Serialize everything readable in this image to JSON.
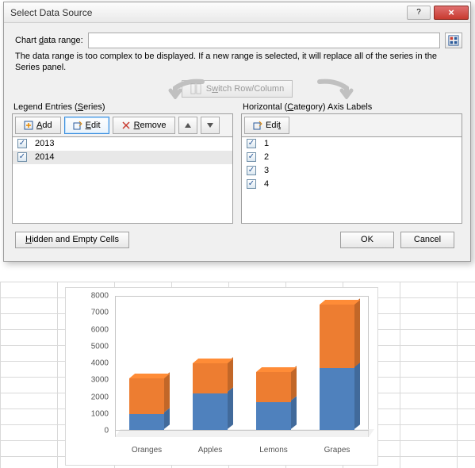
{
  "dialog": {
    "title": "Select Data Source",
    "range_label_pre": "Chart ",
    "range_label_ul": "d",
    "range_label_post": "ata range:",
    "range_value": "",
    "note": "The data range is too complex to be displayed. If a new range is selected, it will replace all of the series in the Series panel.",
    "switch_label_pre": "S",
    "switch_label_ul": "w",
    "switch_label_post": "itch Row/Column",
    "legend_caption_pre": "Legend Entries (",
    "legend_caption_ul": "S",
    "legend_caption_post": "eries)",
    "axis_caption_pre": "Horizontal (",
    "axis_caption_ul": "C",
    "axis_caption_post": "ategory) Axis Labels",
    "add_ul": "A",
    "add_post": "dd",
    "edit_ul": "E",
    "edit_post": "dit",
    "edit2_pre": "Edi",
    "edit2_ul": "t",
    "remove_ul": "R",
    "remove_post": "emove",
    "hidden_ul": "H",
    "hidden_post": "idden and Empty Cells",
    "ok": "OK",
    "cancel": "Cancel",
    "series": [
      "2013",
      "2014"
    ],
    "categories": [
      "1",
      "2",
      "3",
      "4"
    ]
  },
  "chart_data": {
    "type": "bar",
    "stacked": true,
    "three_d": true,
    "categories": [
      "Oranges",
      "Apples",
      "Lemons",
      "Grapes"
    ],
    "series": [
      {
        "name": "2013",
        "color": "#4f81bd",
        "values": [
          1000,
          2200,
          1700,
          3700
        ]
      },
      {
        "name": "2014",
        "color": "#ed7d31",
        "values": [
          2100,
          1800,
          1800,
          3800
        ]
      }
    ],
    "ylim": [
      0,
      8000
    ],
    "yticks": [
      0,
      1000,
      2000,
      3000,
      4000,
      5000,
      6000,
      7000,
      8000
    ],
    "title": "",
    "xlabel": "",
    "ylabel": ""
  }
}
